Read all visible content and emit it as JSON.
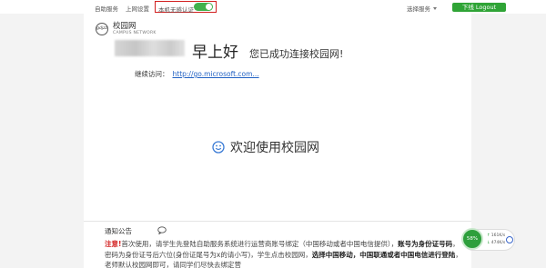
{
  "topbar": {
    "self_service": "自助服务",
    "internet_settings": "上网设置",
    "seamless_auth_label": "本机无感认证",
    "seamless_auth_on": true,
    "select_service": "选择服务",
    "logout_label": "下线 Logout"
  },
  "brand": {
    "name_cn": "校园网",
    "name_en": "CAMPUS NETWORK"
  },
  "greeting": {
    "text": "早上好",
    "connected": "您已成功连接校园网!"
  },
  "continue_visit": {
    "label": "继续访问：",
    "url": "http://go.microsoft.com..."
  },
  "welcome": "欢迎使用校园网",
  "notice": {
    "title": "通知公告",
    "warn": "注意!",
    "line1a": "首次使用，请学生先登陆自助服务系统进行运营商账号绑定（中国移动或者中国电信提供），",
    "line2b": "账号为身份证号码",
    "line2c": "，密码为身份证号后六位(身份证尾号为x的请小写)，学生点击校园网，",
    "line3a": "选择中国移动，中国联通或者中国电信进行登陆",
    "line3b": "，老师默认校园网即可，请同学们尽快去绑定营"
  },
  "widget": {
    "percent": "58%",
    "upload": "161K/s",
    "download": "474K/s"
  },
  "colors": {
    "accent_green": "#2fa436",
    "highlight_red": "#d21f1f",
    "link_blue": "#2262c4"
  }
}
